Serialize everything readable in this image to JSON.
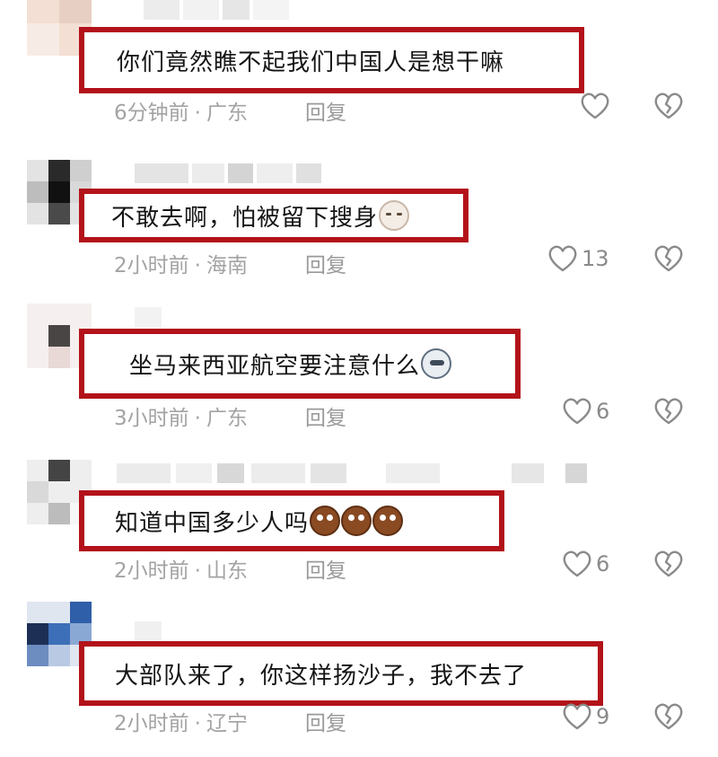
{
  "comments": [
    {
      "text": "你们竟然瞧不起我们中国人是想干嘛",
      "emojis": [],
      "time": "6分钟前",
      "location": "广东",
      "reply": "回复",
      "likes": ""
    },
    {
      "text": "不敢去啊，怕被留下搜身",
      "emojis": [
        "cat-emoji"
      ],
      "time": "2小时前",
      "location": "海南",
      "reply": "回复",
      "likes": "13"
    },
    {
      "text": "坐马来西亚航空要注意什么",
      "emojis": [
        "dog-emoji"
      ],
      "time": "3小时前",
      "location": "广东",
      "reply": "回复",
      "likes": "6"
    },
    {
      "text": "知道中国多少人吗",
      "emojis": [
        "shocked-face-emoji",
        "shocked-face-emoji",
        "shocked-face-emoji"
      ],
      "time": "2小时前",
      "location": "山东",
      "reply": "回复",
      "likes": "6"
    },
    {
      "text": "大部队来了，你这样扬沙子，我不去了",
      "emojis": [],
      "time": "2小时前",
      "location": "辽宁",
      "reply": "回复",
      "likes": "9"
    }
  ],
  "meta_separator": "·",
  "icons": {
    "like": "heart-outline-icon",
    "dislike": "broken-heart-icon"
  },
  "colors": {
    "highlight_border": "#b3121a",
    "meta_text": "#a3a3a3",
    "icon": "#8a8a8a"
  }
}
